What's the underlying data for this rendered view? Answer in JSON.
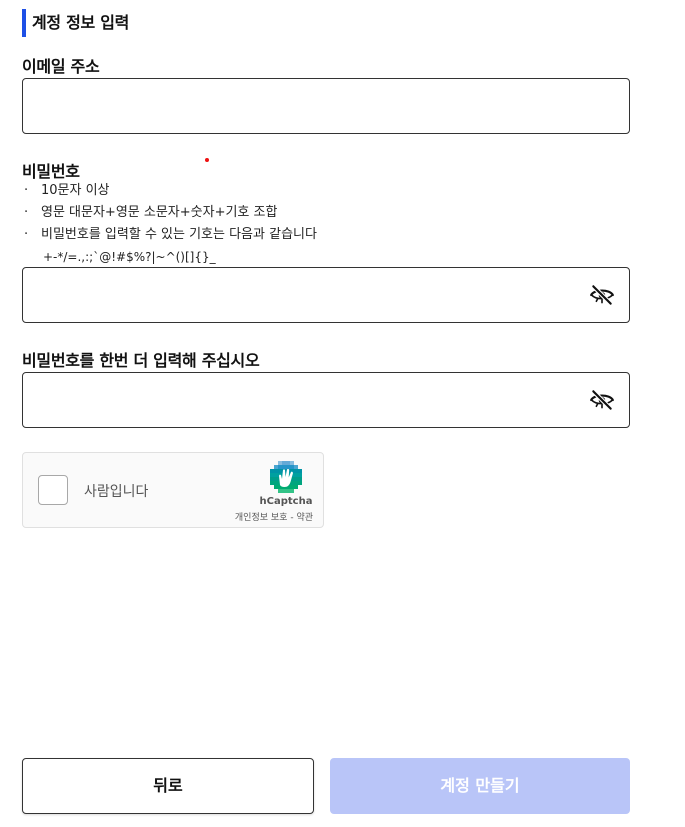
{
  "section_title": "계정 정보 입력",
  "email": {
    "label": "이메일 주소",
    "value": ""
  },
  "password": {
    "label": "비밀번호",
    "rules": [
      "10문자 이상",
      "영문 대문자+영문 소문자+숫자+기호 조합",
      "비밀번호를 입력할 수 있는 기호는 다음과 같습니다"
    ],
    "allowed_symbols": "+-*/=.,:;`@!#$%?|~^()[]{}_",
    "value": "",
    "toggle_icon": "eye-off-icon"
  },
  "password_confirm": {
    "label": "비밀번호를 한번 더 입력해 주십시오",
    "value": "",
    "toggle_icon": "eye-off-icon"
  },
  "captcha": {
    "checkbox_label": "사람입니다",
    "brand": "hCaptcha",
    "privacy_link": "개인정보 보호",
    "separator": " - ",
    "terms_link": "약관"
  },
  "buttons": {
    "back": "뒤로",
    "create_account": "계정 만들기"
  },
  "colors": {
    "accent": "#1e50e6",
    "create_button_disabled": "#b9c5f8",
    "marker_dot": "#e11111"
  }
}
